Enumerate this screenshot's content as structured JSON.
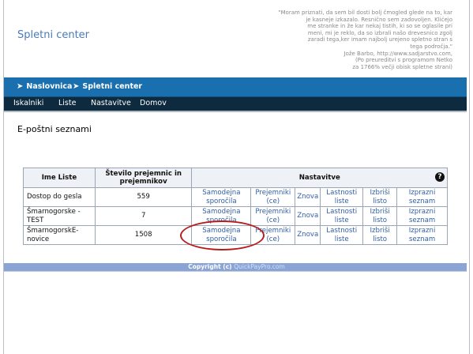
{
  "site": {
    "title": "Spletni center"
  },
  "quote": {
    "lines": [
      "\"Moram priznati, da sem bil dosti bolj čmogled glede na to, kar",
      "je kasneje izkazalo. Resnično sem zadovoljen. Klićejo",
      "me stranke in že kar nekaj tistih, ki so se oglasile pri",
      "meni, mi je reklo, da so izbrali našo drevesnico zgolj",
      "zaradi tega,ker imam najbolj urejeno spletno stran s",
      "tega področja.\"",
      "Jože Barbo, http://www.sadjarstvo.com,",
      "(Po preureditvi s programom Netko",
      "za 1766% večji obisk spletne strani)"
    ]
  },
  "breadcrumb": {
    "items": [
      "Naslovnica",
      "Spletni center"
    ]
  },
  "menu": {
    "items": [
      "Iskalniki",
      "Liste",
      "Nastavitve",
      "Domov"
    ]
  },
  "page": {
    "title": "E-poštni seznami"
  },
  "table": {
    "headers": {
      "name": "Ime Liste",
      "count": "Število prejemnic in prejemnikov",
      "settings": "Nastavitve",
      "help": "?"
    },
    "actions": [
      "Samodejna sporočila",
      "Prejemniki (ce)",
      "Znova",
      "Lastnosti liste",
      "Izbriši listo",
      "Izprazni seznam"
    ],
    "rows": [
      {
        "name": "Dostop do gesla",
        "count": "559"
      },
      {
        "name": "Šmarnogorske - TEST",
        "count": "7"
      },
      {
        "name": "ŠmarnogorskE-novice",
        "count": "1508"
      }
    ]
  },
  "footer": {
    "copyright": "Copyright (c)",
    "brand": "QuickPayPro.com"
  },
  "colors": {
    "accent": "#1a6fae",
    "menu_bg": "#0d2a3f",
    "link": "#2f5fa6",
    "annotation": "#b71c1c"
  }
}
